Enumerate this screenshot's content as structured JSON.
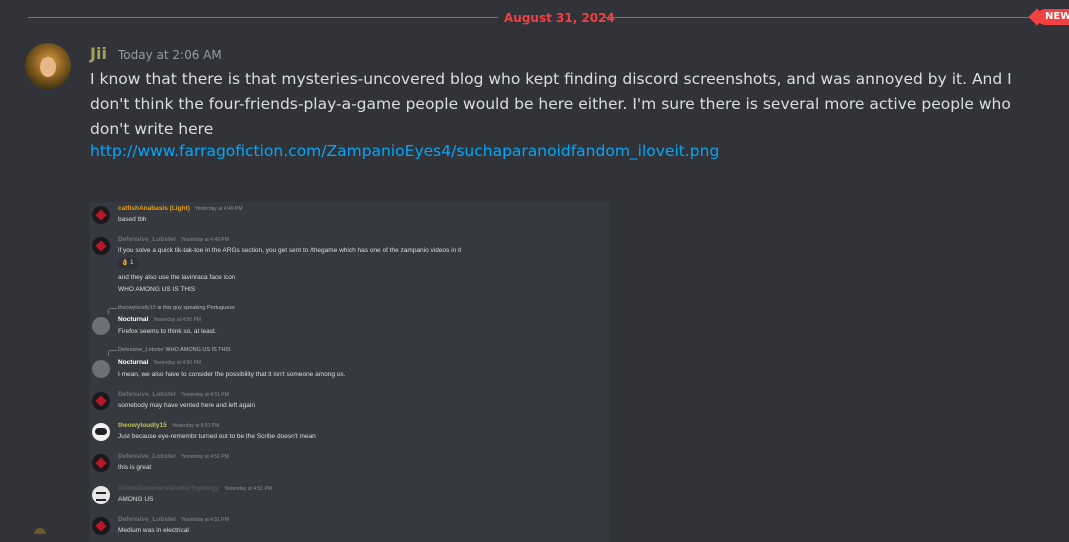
{
  "divider": {
    "date": "August 31, 2024",
    "new_badge": "NEW"
  },
  "message": {
    "author": "Jii",
    "timestamp": "Today at 2:06 AM",
    "text": "I know that there is that mysteries-uncovered blog who kept finding discord screenshots, and was annoyed by it. And I don't think the four-friends-play-a-game people would be here either. I'm sure there is several more active people who don't write here",
    "link": "http://www.farragofiction.com/ZampanioEyes4/suchaparanoidfandom_iloveit.png",
    "author_color": "#a3a05a",
    "link_color": "#00a8fc"
  },
  "screenshot": {
    "entries": [
      {
        "author": "catfishAnabasis (Light)",
        "time": "Yesterday at 4:49 PM",
        "text": "based tbh"
      },
      {
        "author": "Defensive_Lobster",
        "time": "Yesterday at 4:49 PM",
        "text": "if you solve a quick tik-tak-toe in the ARGs section, you get sent to /thegame which has one of the zampanio videos in it",
        "reaction": "👌 1",
        "text2": "and they also use the lavinraca face icon",
        "text3": "WHO AMONG US IS THIS"
      },
      {
        "reply_author": "theowyloudly15",
        "reply_text": " is this guy speaking Portuguese",
        "author": "Nocturnal",
        "time": "Yesterday at 4:50 PM",
        "text": "Firefox seems to think so, at least."
      },
      {
        "reply_author": "Defensive_Lobster",
        "reply_text": " WHO AMONG US IS THIS",
        "author": "Nocturnal",
        "time": "Yesterday at 4:50 PM",
        "text": "I mean, we also have to consider the possibility that it isn't someone among us."
      },
      {
        "author": "Defensive_Lobster",
        "time": "Yesterday at 4:51 PM",
        "text": "somebody may have vented here and left again"
      },
      {
        "author": "theowyloudly15",
        "time": "Yesterday at 4:51 PM",
        "text": "Just because eye-remembr turned out to be the Scribe doesn't mean"
      },
      {
        "author": "Defensive_Lobster",
        "time": "Yesterday at 4:51 PM",
        "text": "this is great"
      },
      {
        "author": "ArtistsDreamersShelterTopology",
        "time": "Yesterday at 4:51 PM",
        "text": "AMONG US"
      },
      {
        "author": "Defensive_Lobster",
        "time": "Yesterday at 4:51 PM",
        "text": "Medium was in electrical"
      }
    ]
  }
}
